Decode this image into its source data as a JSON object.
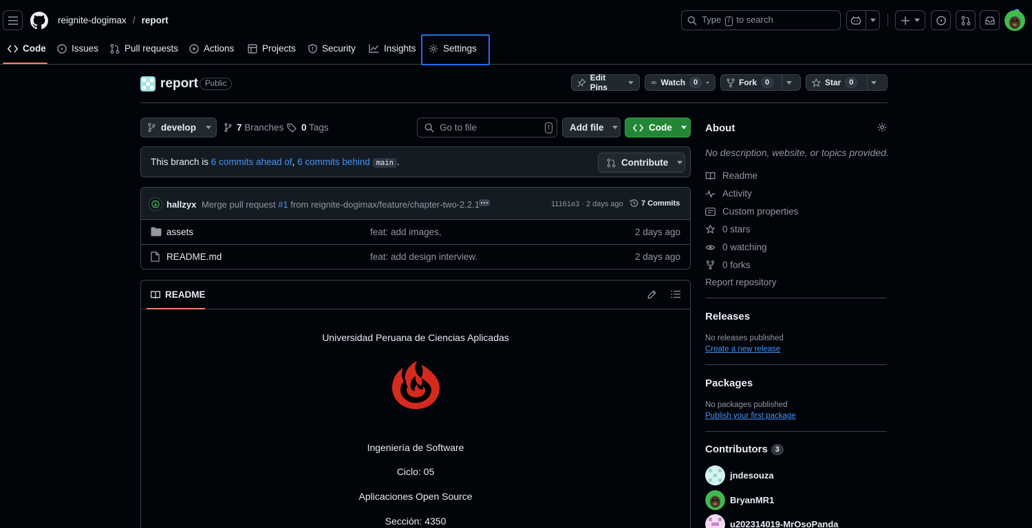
{
  "header": {
    "owner": "reignite-dogimax",
    "separator": "/",
    "repo": "report",
    "search_prefix": "Type",
    "search_key": "/",
    "search_suffix": "to search"
  },
  "nav": {
    "tabs": [
      {
        "label": "Code"
      },
      {
        "label": "Issues"
      },
      {
        "label": "Pull requests"
      },
      {
        "label": "Actions"
      },
      {
        "label": "Projects"
      },
      {
        "label": "Security"
      },
      {
        "label": "Insights"
      },
      {
        "label": "Settings"
      }
    ]
  },
  "repo": {
    "name": "report",
    "visibility": "Public",
    "edit_pins": "Edit Pins",
    "watch": "Watch",
    "watch_count": "0",
    "fork": "Fork",
    "fork_count": "0",
    "star": "Star",
    "star_count": "0"
  },
  "branchbar": {
    "branch": "develop",
    "branches_count": "7",
    "branches_label": "Branches",
    "tags_count": "0",
    "tags_label": "Tags",
    "goto_placeholder": "Go to file",
    "goto_key": "t",
    "add_file": "Add file",
    "code": "Code"
  },
  "status": {
    "prefix": "This branch is ",
    "ahead": "6 commits ahead of",
    "comma": ", ",
    "behind": "6 commits behind",
    "base": "main",
    "period": ".",
    "contribute": "Contribute"
  },
  "commit": {
    "author": "hallzyx",
    "message_prefix": "Merge pull request ",
    "pr": "#1",
    "message_suffix": " from reignite-dogimax/feature/chapter-two-2.2.1",
    "sha_time": "11161e3 · 2 days ago",
    "commits": "7 Commits"
  },
  "files": [
    {
      "name": "assets",
      "type": "folder",
      "message": "feat: add images,",
      "time": "2 days ago"
    },
    {
      "name": "README.md",
      "type": "file",
      "message": "feat: add design interview.",
      "time": "2 days ago"
    }
  ],
  "readme": {
    "tab": "README",
    "lines": [
      "Universidad Peruana de Ciencias Aplicadas",
      "Ingeniería de Software",
      "Ciclo: 05",
      "Aplicaciones Open Source",
      "Sección: 4350"
    ]
  },
  "about": {
    "title": "About",
    "description": "No description, website, or topics provided.",
    "items": [
      {
        "label": "Readme",
        "icon": "book-icon"
      },
      {
        "label": "Activity",
        "icon": "pulse-icon"
      },
      {
        "label": "Custom properties",
        "icon": "note-icon"
      },
      {
        "label": "0 stars",
        "icon": "star-icon"
      },
      {
        "label": "0 watching",
        "icon": "eye-icon"
      },
      {
        "label": "0 forks",
        "icon": "fork-icon"
      }
    ],
    "report": "Report repository"
  },
  "releases": {
    "title": "Releases",
    "empty": "No releases published",
    "link": "Create a new release"
  },
  "packages": {
    "title": "Packages",
    "empty": "No packages published",
    "link": "Publish your first package"
  },
  "contributors": {
    "title": "Contributors",
    "count": "3",
    "list": [
      "jndesouza",
      "BryanMR1",
      "u202314019-MrOsoPanda"
    ]
  },
  "colors": {
    "accent": "#f78166",
    "link": "#4493f8",
    "green": "#238636",
    "logo_red": "#d52b1e"
  }
}
